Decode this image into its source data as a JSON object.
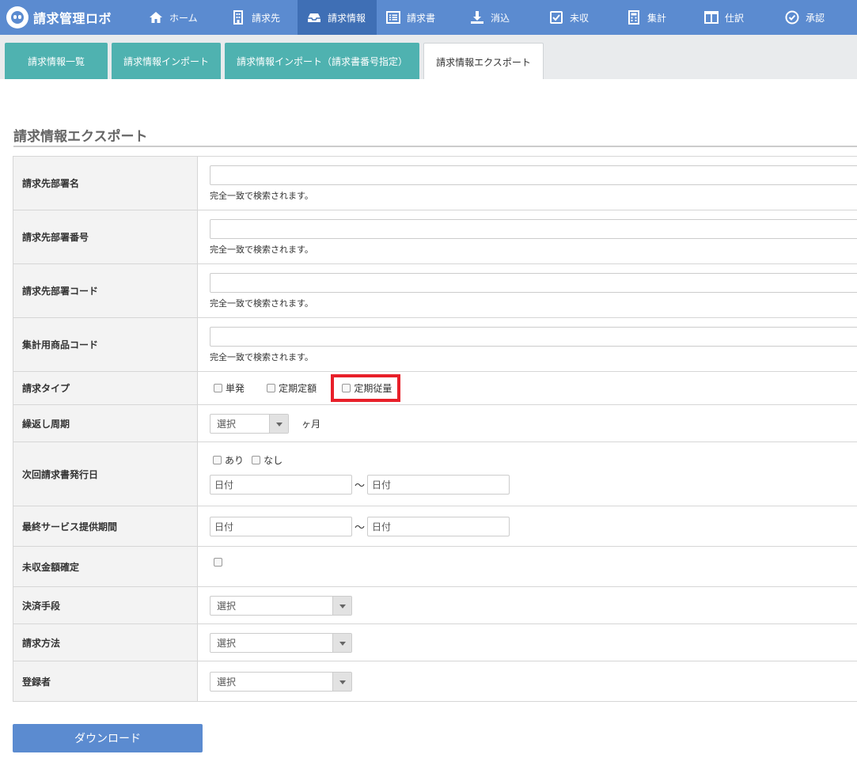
{
  "app": {
    "title": "請求管理ロボ"
  },
  "nav": [
    {
      "label": "ホーム",
      "icon": "home-icon"
    },
    {
      "label": "請求先",
      "icon": "building-icon"
    },
    {
      "label": "請求情報",
      "icon": "inbox-icon"
    },
    {
      "label": "請求書",
      "icon": "list-icon"
    },
    {
      "label": "消込",
      "icon": "download-icon"
    },
    {
      "label": "未収",
      "icon": "checkbox-icon"
    },
    {
      "label": "集計",
      "icon": "calculator-icon"
    },
    {
      "label": "仕訳",
      "icon": "columns-icon"
    },
    {
      "label": "承認",
      "icon": "check-circle-icon"
    }
  ],
  "nav_active": "請求情報",
  "tabs": [
    {
      "label": "請求情報一覧"
    },
    {
      "label": "請求情報インポート"
    },
    {
      "label": "請求情報インポート（請求書番号指定）"
    },
    {
      "label": "請求情報エクスポート"
    }
  ],
  "section": {
    "title": "請求情報エクスポート"
  },
  "form": {
    "exact_match_hint": "完全一致で検索されます。",
    "billing_dept_name": {
      "label": "請求先部署名",
      "value": ""
    },
    "billing_dept_number": {
      "label": "請求先部署番号",
      "value": ""
    },
    "billing_dept_code": {
      "label": "請求先部署コード",
      "value": ""
    },
    "aggregate_product_code": {
      "label": "集計用商品コード",
      "value": ""
    },
    "billing_type": {
      "label": "請求タイプ",
      "options": [
        "単発",
        "定期定額",
        "定期従量"
      ]
    },
    "repeat_cycle": {
      "label": "繰返し周期",
      "select": "選択",
      "unit": "ヶ月"
    },
    "next_issue_date": {
      "label": "次回請求書発行日",
      "options": [
        "あり",
        "なし"
      ],
      "from_placeholder": "日付",
      "to_placeholder": "日付",
      "separator": "～"
    },
    "last_service_period": {
      "label": "最終サービス提供期間",
      "from_placeholder": "日付",
      "to_placeholder": "日付",
      "separator": "～"
    },
    "unpaid_amount_confirmed": {
      "label": "未収金額確定"
    },
    "payment_method": {
      "label": "決済手段",
      "select": "選択"
    },
    "billing_method": {
      "label": "請求方法",
      "select": "選択"
    },
    "registrant": {
      "label": "登録者",
      "select": "選択"
    }
  },
  "actions": {
    "download_label": "ダウンロード"
  },
  "colors": {
    "nav": "#5b8bd0",
    "nav_active": "#3f6fb5",
    "tab": "#4fb2b0",
    "highlight": "#e8202a"
  }
}
